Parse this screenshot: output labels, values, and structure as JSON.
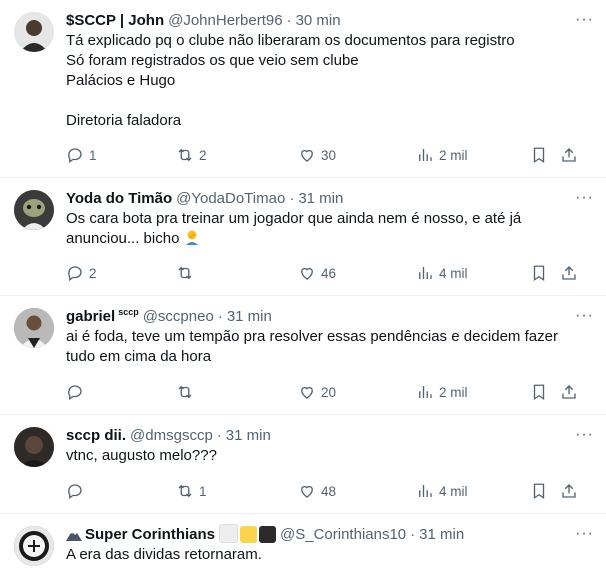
{
  "tweets": [
    {
      "name": "$SCCP | John",
      "handle": "@JohnHerbert96",
      "time": "30 min",
      "lines": [
        "Tá explicado pq o clube não liberaram os documentos para registro",
        "Só foram registrados os que veio sem clube",
        "Palácios e Hugo",
        "",
        "Diretoria faladora"
      ],
      "replies": "1",
      "reposts": "2",
      "likes": "30",
      "views": "2 mil"
    },
    {
      "name": "Yoda do Timão",
      "handle": "@YodaDoTimao",
      "time": "31 min",
      "lines": [
        "Os cara bota pra treinar um jogador que ainda nem é nosso, e até já",
        "anunciou... bicho"
      ],
      "emoji": "person-facepalming",
      "replies": "2",
      "reposts": "",
      "likes": "46",
      "views": "4 mil"
    },
    {
      "name": "gabriel",
      "name_suffix": "sccp",
      "handle": "@sccpneo",
      "time": "31 min",
      "lines": [
        "ai é foda, teve um tempão pra resolver essas pendências e decidem fazer",
        "tudo em cima da hora"
      ],
      "replies": "",
      "reposts": "",
      "likes": "20",
      "views": "2 mil"
    },
    {
      "name": "sccp dii.",
      "handle": "@dmsgsccp",
      "time": "31 min",
      "lines": [
        "vtnc, augusto melo???"
      ],
      "replies": "",
      "reposts": "1",
      "likes": "48",
      "views": "4 mil"
    },
    {
      "name": "Super Corinthians",
      "handle": "@S_Corinthians10",
      "time": "31 min",
      "lines": [
        "A era das dividas retornaram."
      ],
      "name_squares": [
        "#f1f1f1",
        "#fcd34d",
        "#2b2b2b"
      ]
    }
  ],
  "separator": "·",
  "more_icon": "more-dots-icon",
  "colors": {
    "text": "#0f1419",
    "muted": "#536471",
    "divider": "#eff3f4"
  }
}
